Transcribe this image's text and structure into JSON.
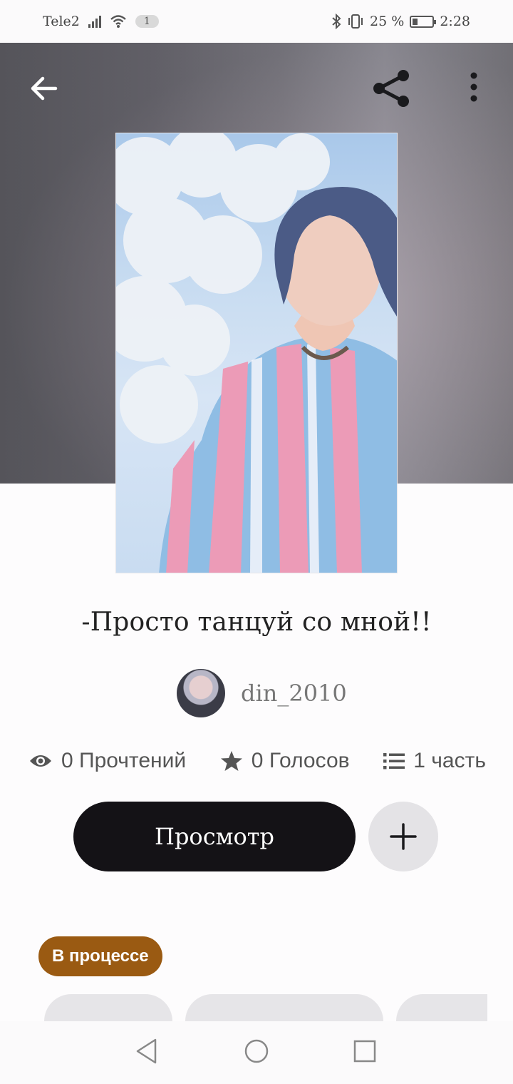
{
  "status_bar": {
    "carrier": "Tele2",
    "notification_count": "1",
    "battery_percent": "25 %",
    "time": "2:28"
  },
  "story": {
    "title": "-Просто танцуй со мной!!",
    "author": "din_2010",
    "reads": "0 Прочтений",
    "votes": "0 Голосов",
    "parts": "1 часть",
    "status": "В процессе"
  },
  "actions": {
    "read_label": "Просмотр"
  },
  "icons": {
    "back": "arrow-left-icon",
    "share": "share-icon",
    "more": "more-vertical-icon",
    "reads": "eye-icon",
    "votes": "star-icon",
    "parts": "list-icon",
    "add": "plus-icon"
  }
}
